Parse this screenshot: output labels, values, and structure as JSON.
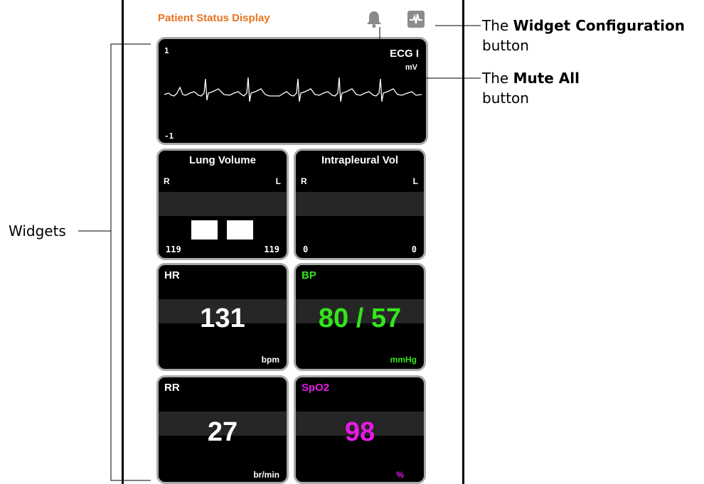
{
  "app": {
    "title": "Patient Status Display"
  },
  "toolbar": {
    "mute_icon": "bell-icon",
    "config_icon": "waveform-icon"
  },
  "colors": {
    "title": "#e8731f",
    "bp": "#33e61a",
    "spo2": "#e61ae6",
    "normal": "#ffffff"
  },
  "ecg": {
    "label": "ECG I",
    "unit": "mV",
    "y_top": "1",
    "y_bottom": "-1"
  },
  "lung_volume": {
    "title": "Lung Volume",
    "left": "R",
    "right": "L",
    "value_left": "119",
    "value_right": "119"
  },
  "intrapleural": {
    "title": "Intrapleural Vol",
    "left": "R",
    "right": "L",
    "value_left": "0",
    "value_right": "0"
  },
  "hr": {
    "label": "HR",
    "value": "131",
    "unit": "bpm"
  },
  "bp": {
    "label": "BP",
    "value": "80 / 57",
    "unit": "mmHg"
  },
  "rr": {
    "label": "RR",
    "value": "27",
    "unit": "br/min"
  },
  "spo2": {
    "label": "SpO2",
    "value": "98",
    "unit": "%"
  },
  "callouts": {
    "widget_config_pre": "The ",
    "widget_config_bold": "Widget Configuration",
    "widget_config_post": "button",
    "mute_pre": "The ",
    "mute_bold": "Mute All",
    "mute_post": "button",
    "widgets": "Widgets"
  }
}
